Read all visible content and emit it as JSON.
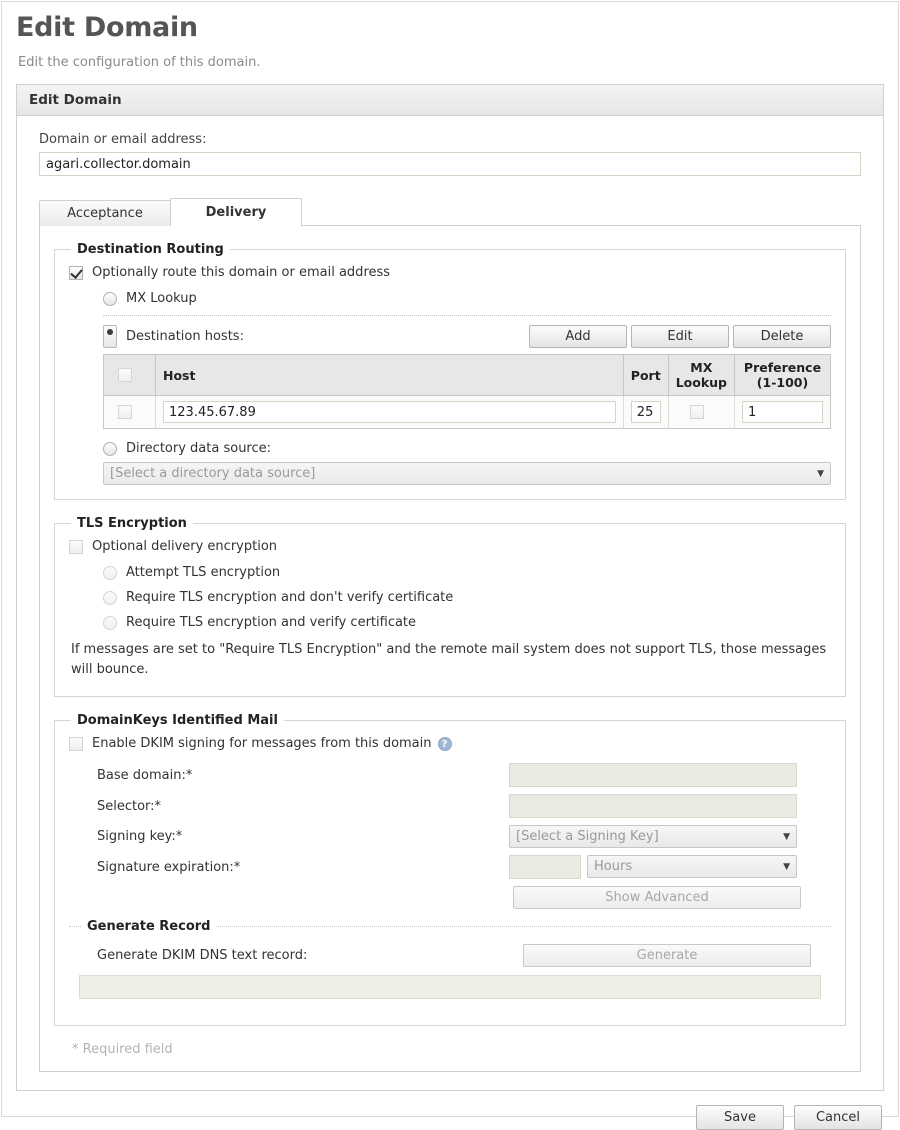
{
  "page": {
    "title": "Edit Domain",
    "subtitle": "Edit the configuration of this domain."
  },
  "panel": {
    "header": "Edit Domain"
  },
  "domain_field": {
    "label": "Domain or email address:",
    "value": "agari.collector.domain"
  },
  "tabs": [
    {
      "label": "Acceptance",
      "active": false
    },
    {
      "label": "Delivery",
      "active": true
    }
  ],
  "destination_routing": {
    "legend": "Destination Routing",
    "enable_label": "Optionally route this domain or email address",
    "enable_checked": true,
    "mx_lookup_label": "MX Lookup",
    "destination_hosts_label": "Destination hosts:",
    "buttons": {
      "add": "Add",
      "edit": "Edit",
      "delete": "Delete"
    },
    "table": {
      "headers": [
        "",
        "Host",
        "Port",
        "MX Lookup",
        "Preference (1-100)"
      ],
      "header_mx_line1": "MX",
      "header_mx_line2": "Lookup",
      "header_pref_line1": "Preference",
      "header_pref_line2": "(1-100)",
      "rows": [
        {
          "selected": false,
          "host": "123.45.67.89",
          "port": "25",
          "mx_lookup": false,
          "preference": "1"
        }
      ]
    },
    "directory_label": "Directory data source:",
    "directory_placeholder": "[Select a directory data source]"
  },
  "tls": {
    "legend": "TLS Encryption",
    "optional_label": "Optional delivery encryption",
    "options": [
      "Attempt TLS encryption",
      "Require TLS encryption and don't verify certificate",
      "Require TLS encryption and verify certificate"
    ],
    "note": "If messages are set to \"Require TLS Encryption\" and the remote mail system does not support TLS, those messages will bounce."
  },
  "dkim": {
    "legend": "DomainKeys Identified Mail",
    "enable_label": "Enable DKIM signing for messages from this domain",
    "help_icon": "?",
    "fields": {
      "base_domain_label": "Base domain:*",
      "base_domain_value": "",
      "selector_label": "Selector:*",
      "selector_value": "",
      "signing_key_label": "Signing key:*",
      "signing_key_value": "[Select a Signing Key]",
      "signature_expiration_label": "Signature expiration:*",
      "signature_expiration_value": "",
      "signature_expiration_unit": "Hours"
    },
    "show_advanced_label": "Show Advanced",
    "generate_record": {
      "legend": "Generate Record",
      "label": "Generate DKIM DNS text record:",
      "button": "Generate",
      "output": ""
    }
  },
  "required_note": "* Required field",
  "footer": {
    "save": "Save",
    "cancel": "Cancel"
  }
}
